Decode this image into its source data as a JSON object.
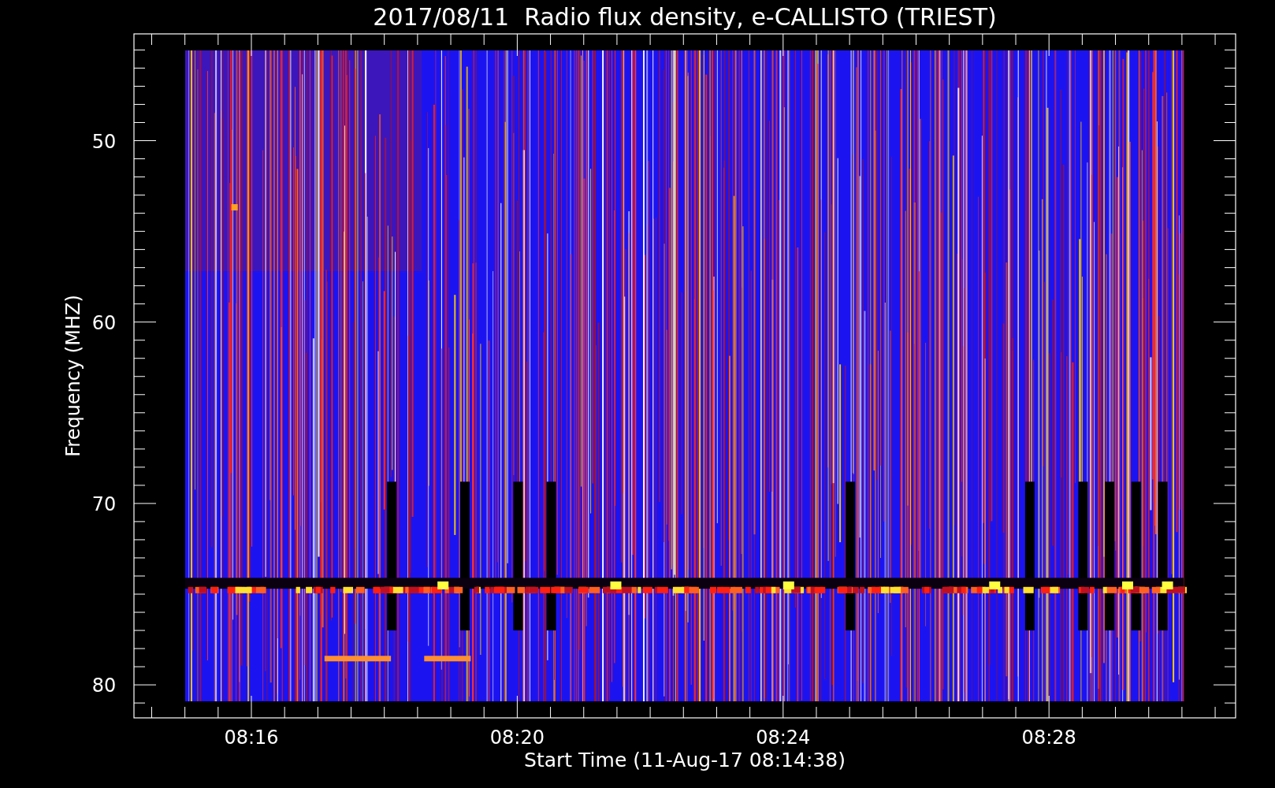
{
  "plot": {
    "title": "2017/08/11  Radio flux density, e-CALLISTO (TRIEST)",
    "y_axis": {
      "label": "Frequency (MHZ)",
      "ticks": [
        "50",
        "60",
        "70",
        "80"
      ]
    },
    "x_axis": {
      "label": "Start Time (11-Aug-17 08:14:38)",
      "ticks": [
        "08:16",
        "08:20",
        "08:24",
        "08:28"
      ]
    }
  }
}
